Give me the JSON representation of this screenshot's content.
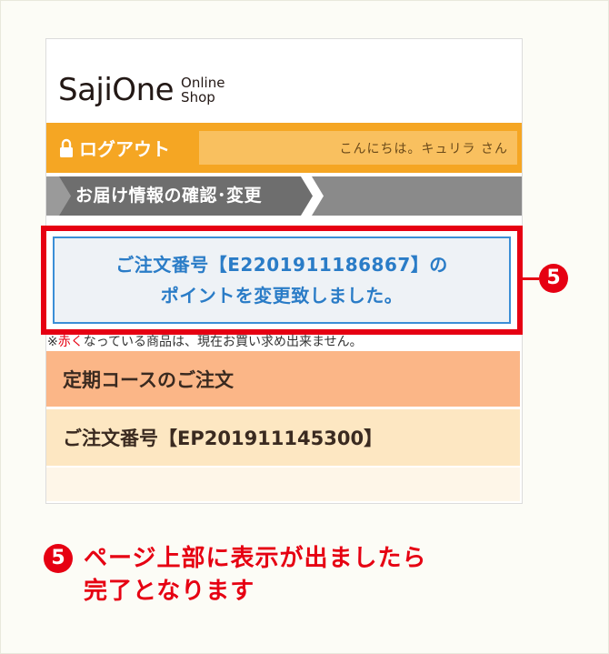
{
  "header": {
    "logo_main": "SajiOne",
    "logo_sub_line1": "Online",
    "logo_sub_line2": "Shop"
  },
  "account_bar": {
    "logout_label": "ログアウト",
    "greeting": "こんにちは。キュリラ さん"
  },
  "breadcrumb": {
    "label": "お届け情報の確認･変更"
  },
  "notice": {
    "line1": "ご注文番号【E2201911186867】の",
    "line2": "ポイントを変更致しました。"
  },
  "note": {
    "prefix": "※",
    "red_word": "赤く",
    "suffix": "なっている商品は、現在お買い求め出来ません。"
  },
  "rows": {
    "course_title": "定期コースのご注文",
    "order_number": "ご注文番号【EP201911145300】"
  },
  "annotation": {
    "step_number": "5",
    "caption_line1": "ページ上部に表示が出ましたら",
    "caption_line2": "完了となります"
  },
  "colors": {
    "orange": "#f5a623",
    "highlight_red": "#e60012",
    "notice_blue": "#2a7cc7"
  }
}
